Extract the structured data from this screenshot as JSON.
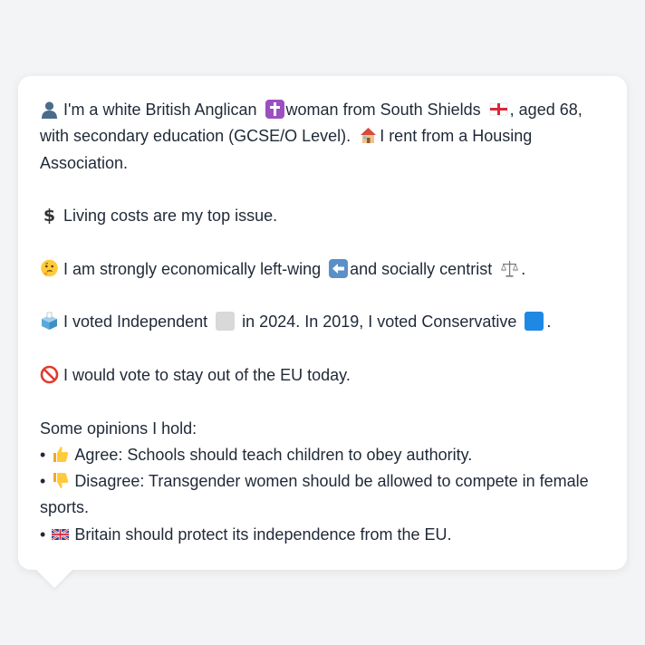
{
  "colors": {
    "background": "#f3f4f6",
    "card": "#ffffff",
    "text": "#1f2937",
    "independent_square": "#d9d9d9",
    "conservative_square": "#1e88e5"
  },
  "profile": {
    "line1_a": "I'm a white British Anglican",
    "line1_b": "woman from South Shields",
    "line1_c": ", aged 68,",
    "line2_a": "with secondary education (GCSE/O Level).",
    "line2_b": "I rent from a Housing",
    "line3": "Association.",
    "icons": [
      "person-icon",
      "latin-cross-icon",
      "england-flag-icon",
      "house-icon"
    ]
  },
  "issue": {
    "icon": "dollar-icon",
    "text": "Living costs are my top issue."
  },
  "ideology": {
    "icon": "thinking-face-icon",
    "text_a": "I am strongly economically left-wing",
    "text_b": "and socially centrist",
    "text_c": ".",
    "icons": [
      "left-arrow-icon",
      "balance-scale-icon"
    ]
  },
  "vote": {
    "icon": "ballot-box-icon",
    "text_a": "I voted Independent",
    "text_b": "in 2024. In 2019, I voted Conservative",
    "text_c": "."
  },
  "eu": {
    "icon": "prohibited-icon",
    "text": "I would vote to stay out of the EU today."
  },
  "opinions": {
    "heading": "Some opinions I hold:",
    "bullet": "•",
    "items": [
      {
        "icon": "thumbs-up-icon",
        "text": "Agree: Schools should teach children to obey authority."
      },
      {
        "icon": "thumbs-down-icon",
        "text_line1": "Disagree: Transgender women should be allowed to compete in female",
        "text_line2": "sports."
      },
      {
        "icon": "uk-flag-icon",
        "text": "Britain should protect its independence from the EU."
      }
    ]
  }
}
